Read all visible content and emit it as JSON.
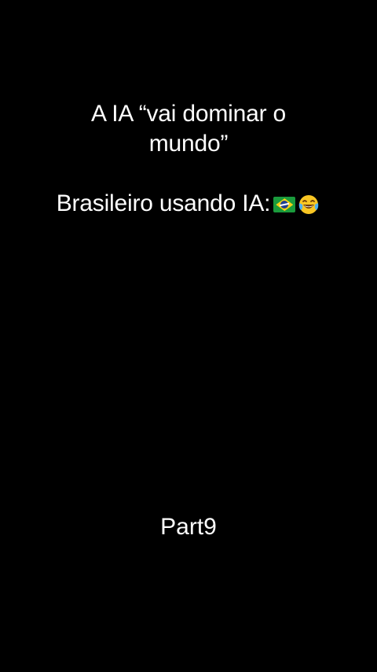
{
  "caption": {
    "line1": "A IA “vai dominar o",
    "line2": "mundo”",
    "line3": "Brasileiro usando IA:",
    "emojis": [
      "brazil-flag-icon",
      "face-with-tears-of-joy-icon"
    ]
  },
  "footer": {
    "part": "Part9"
  },
  "colors": {
    "background": "#000000",
    "text": "#ffffff"
  }
}
